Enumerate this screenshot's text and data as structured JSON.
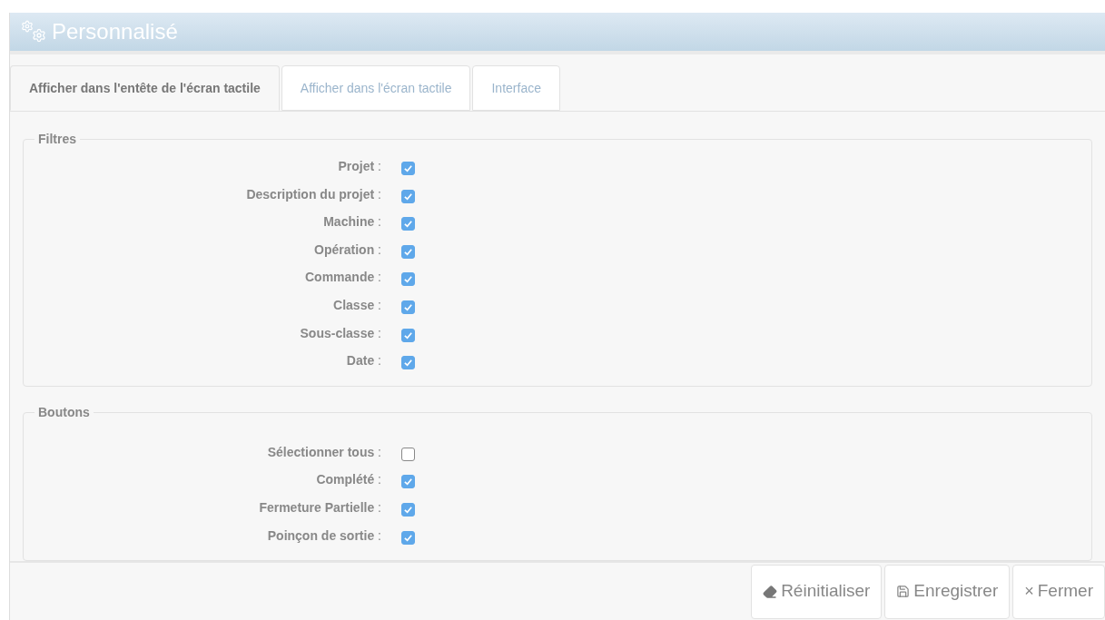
{
  "window": {
    "title": "Personnalisé"
  },
  "tabs": [
    {
      "label": "Afficher dans l'entête de l'écran tactile",
      "selected": true
    },
    {
      "label": "Afficher dans l'écran tactile",
      "selected": false
    },
    {
      "label": "Interface",
      "selected": false
    }
  ],
  "groups": [
    {
      "title": "Filtres",
      "items": [
        {
          "label": "**Projet** :",
          "checked": true
        },
        {
          "label": "**Description du projet** :",
          "checked": true
        },
        {
          "label": "**Machine** :",
          "checked": true
        },
        {
          "label": "**Opération** :",
          "checked": true
        },
        {
          "label": "**Commande** :",
          "checked": true
        },
        {
          "label": "**Classe** :",
          "checked": true
        },
        {
          "label": "**Sous-classe** :",
          "checked": true
        },
        {
          "label": "**Date** :",
          "checked": true
        }
      ]
    },
    {
      "title": "Boutons",
      "items": [
        {
          "label": "**Sélectionner tous** :",
          "checked": false
        },
        {
          "label": "**Complété** :",
          "checked": true
        },
        {
          "label": "**Fermeture Partielle** :",
          "checked": true
        },
        {
          "label": "**Poinçon de sortie** :",
          "checked": true
        }
      ]
    }
  ],
  "buttons": [
    {
      "kind": "reset",
      "label": "Réinitialiser"
    },
    {
      "kind": "save",
      "label": "Enregistrer"
    },
    {
      "kind": "close",
      "icon": "×",
      "label": "Fermer"
    }
  ]
}
